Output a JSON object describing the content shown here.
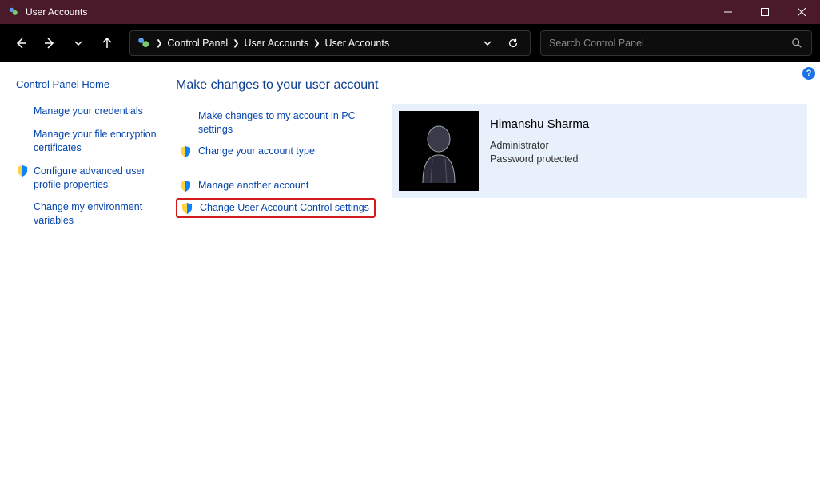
{
  "window": {
    "title": "User Accounts"
  },
  "breadcrumb": {
    "root": "Control Panel",
    "level1": "User Accounts",
    "level2": "User Accounts"
  },
  "search": {
    "placeholder": "Search Control Panel"
  },
  "sidebar": {
    "home": "Control Panel Home",
    "items": [
      {
        "label": "Manage your credentials",
        "shield": false
      },
      {
        "label": "Manage your file encryption certificates",
        "shield": false
      },
      {
        "label": "Configure advanced user profile properties",
        "shield": true
      },
      {
        "label": "Change my environment variables",
        "shield": false
      }
    ]
  },
  "main": {
    "heading": "Make changes to your user account",
    "actions_top": [
      {
        "label": "Make changes to my account in PC settings",
        "shield": false
      },
      {
        "label": "Change your account type",
        "shield": true
      }
    ],
    "actions_bottom": [
      {
        "label": "Manage another account",
        "shield": true
      },
      {
        "label": "Change User Account Control settings",
        "shield": true,
        "highlight": true
      }
    ]
  },
  "user": {
    "name": "Himanshu Sharma",
    "role": "Administrator",
    "password_status": "Password protected"
  },
  "help": {
    "label": "?"
  }
}
